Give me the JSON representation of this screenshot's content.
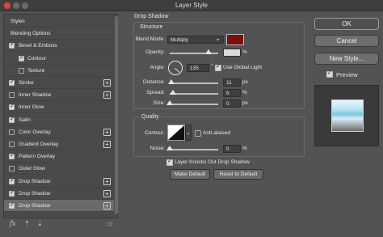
{
  "window": {
    "title": "Layer Style"
  },
  "styles_list": {
    "items": [
      {
        "label": "Styles",
        "checkbox": null,
        "plus": false,
        "indent": false,
        "selected": false
      },
      {
        "label": "Blending Options",
        "checkbox": null,
        "plus": false,
        "indent": false,
        "selected": false
      },
      {
        "label": "Bevel & Emboss",
        "checkbox": true,
        "plus": false,
        "indent": false,
        "selected": false
      },
      {
        "label": "Contour",
        "checkbox": true,
        "plus": false,
        "indent": true,
        "selected": false
      },
      {
        "label": "Texture",
        "checkbox": false,
        "plus": false,
        "indent": true,
        "selected": false
      },
      {
        "label": "Stroke",
        "checkbox": true,
        "plus": true,
        "indent": false,
        "selected": false
      },
      {
        "label": "Inner Shadow",
        "checkbox": false,
        "plus": true,
        "indent": false,
        "selected": false
      },
      {
        "label": "Inner Glow",
        "checkbox": true,
        "plus": false,
        "indent": false,
        "selected": false
      },
      {
        "label": "Satin",
        "checkbox": true,
        "plus": false,
        "indent": false,
        "selected": false
      },
      {
        "label": "Color Overlay",
        "checkbox": false,
        "plus": true,
        "indent": false,
        "selected": false
      },
      {
        "label": "Gradient Overlay",
        "checkbox": false,
        "plus": true,
        "indent": false,
        "selected": false
      },
      {
        "label": "Pattern Overlay",
        "checkbox": true,
        "plus": false,
        "indent": false,
        "selected": false
      },
      {
        "label": "Outer Glow",
        "checkbox": false,
        "plus": false,
        "indent": false,
        "selected": false
      },
      {
        "label": "Drop Shadow",
        "checkbox": true,
        "plus": true,
        "indent": false,
        "selected": false
      },
      {
        "label": "Drop Shadow",
        "checkbox": true,
        "plus": true,
        "indent": false,
        "selected": false
      },
      {
        "label": "Drop Shadow",
        "checkbox": true,
        "plus": true,
        "indent": false,
        "selected": true
      }
    ],
    "footer_icons": [
      "fx-icon",
      "move-up-icon",
      "move-down-icon",
      "trash-icon"
    ],
    "footer_fx": "fx"
  },
  "panel": {
    "title": "Drop Shadow",
    "structure": {
      "heading": "Structure",
      "blend_mode_label": "Blend Mode:",
      "blend_mode_value": "Multiply",
      "shadow_color": "#7a0f10",
      "opacity_label": "Opacity:",
      "opacity_value": "",
      "opacity_unit": "%",
      "angle_label": "Angle:",
      "angle_value": "135",
      "angle_unit": "°",
      "global_light_label": "Use Global Light",
      "global_light_checked": true,
      "distance_label": "Distance:",
      "distance_value": "11",
      "distance_unit": "px",
      "spread_label": "Spread:",
      "spread_value": "6",
      "spread_unit": "%",
      "size_label": "Size:",
      "size_value": "0",
      "size_unit": "px"
    },
    "quality": {
      "heading": "Quality",
      "contour_label": "Contour:",
      "anti_aliased_label": "Anti-aliased",
      "anti_aliased_checked": false,
      "noise_label": "Noise:",
      "noise_value": "0",
      "noise_unit": "%"
    },
    "knockout_label": "Layer Knocks Out Drop Shadow",
    "knockout_checked": true,
    "make_default_label": "Make Default",
    "reset_default_label": "Reset to Default"
  },
  "actions": {
    "ok_label": "OK",
    "cancel_label": "Cancel",
    "new_style_label": "New Style...",
    "preview_label": "Preview",
    "preview_checked": true
  }
}
